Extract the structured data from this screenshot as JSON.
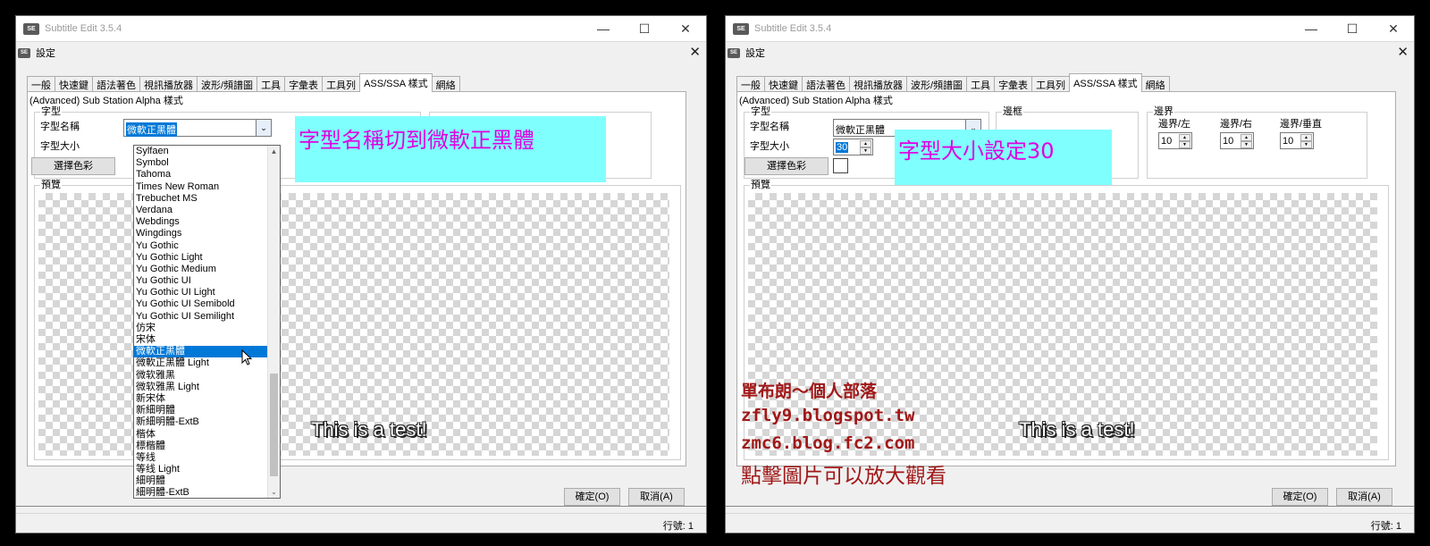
{
  "app": {
    "title": "Subtitle Edit 3.5.4",
    "min": "—",
    "max": "☐",
    "close": "✕"
  },
  "dialog": {
    "title": "設定",
    "close": "✕"
  },
  "tabs": [
    "一般",
    "快速鍵",
    "語法著色",
    "視訊播放器",
    "波形/頻譜圖",
    "工具",
    "字彙表",
    "工具列",
    "ASS/SSA 樣式",
    "網絡"
  ],
  "section_title": "(Advanced) Sub Station Alpha 樣式",
  "font_group": {
    "label": "字型",
    "font_name_label": "字型名稱",
    "font_size_label": "字型大小",
    "choose_color": "選擇色彩"
  },
  "outline_group": {
    "label": "邊框"
  },
  "margin_group": {
    "label": "邊界",
    "left_label": "邊界/左",
    "right_label": "邊界/右",
    "vertical_label": "邊界/垂直",
    "left": "10",
    "right": "10",
    "vertical": "10",
    "vertical_partial": "直"
  },
  "preview": {
    "label": "預覽",
    "sample": "This is a test!"
  },
  "buttons": {
    "ok": "確定(O)",
    "cancel": "取消(A)"
  },
  "status": {
    "line": "行號: 1"
  },
  "left": {
    "font_name": "微軟正黑體",
    "font_list": [
      "Sylfaen",
      "Symbol",
      "Tahoma",
      "Times New Roman",
      "Trebuchet MS",
      "Verdana",
      "Webdings",
      "Wingdings",
      "Yu Gothic",
      "Yu Gothic Light",
      "Yu Gothic Medium",
      "Yu Gothic UI",
      "Yu Gothic UI Light",
      "Yu Gothic UI Semibold",
      "Yu Gothic UI Semilight",
      "仿宋",
      "宋体",
      "微軟正黑體",
      "微軟正黑體 Light",
      "微软雅黑",
      "微软雅黑 Light",
      "新宋体",
      "新細明體",
      "新細明體-ExtB",
      "楷体",
      "標楷體",
      "等线",
      "等线 Light",
      "細明體",
      "細明體-ExtB"
    ],
    "highlighted": "微軟正黑體",
    "annotation": "字型名稱切到微軟正黑體"
  },
  "right": {
    "font_name": "微軟正黑體",
    "font_size": "30",
    "annotation": "字型大小設定30",
    "blog": [
      "單布朗～個人部落",
      "zfly9.blogspot.tw",
      "zmc6.blog.fc2.com",
      "點擊圖片可以放大觀看"
    ]
  },
  "colors": {
    "annotation_bg": "#80ffff",
    "annotation_text": "#e000e0",
    "selection": "#0078d7",
    "blog_text": "#a01818"
  }
}
